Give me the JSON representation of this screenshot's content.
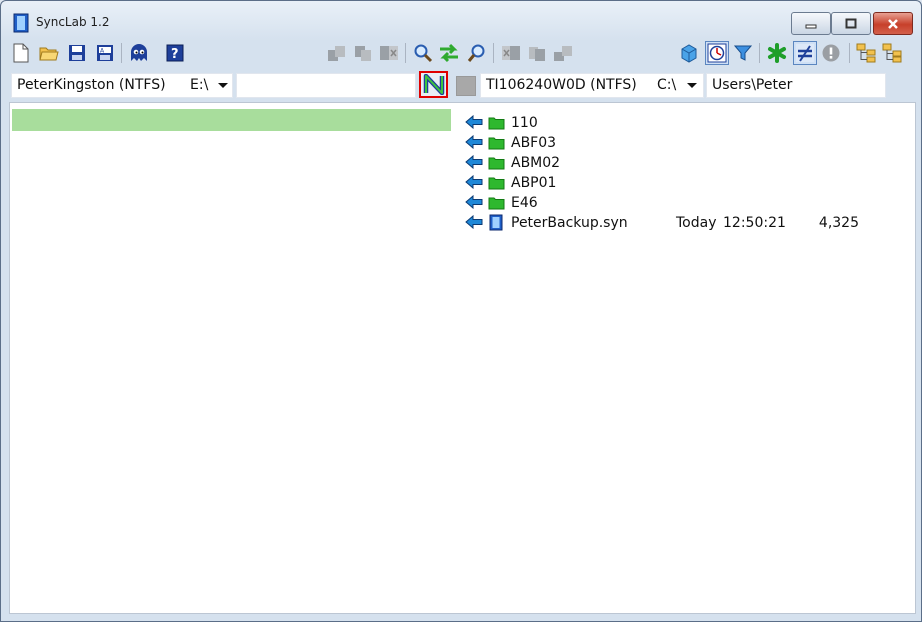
{
  "window": {
    "title": "SyncLab 1.2"
  },
  "left": {
    "volume": "PeterKingston (NTFS)",
    "drive": "E:\\",
    "path": ""
  },
  "right": {
    "volume": "TI106240W0D (NTFS)",
    "drive": "C:\\",
    "path": "Users\\Peter"
  },
  "files": [
    {
      "name": "110",
      "type": "folder",
      "date": "",
      "time": "",
      "size": ""
    },
    {
      "name": "ABF03",
      "type": "folder",
      "date": "",
      "time": "",
      "size": ""
    },
    {
      "name": "ABM02",
      "type": "folder",
      "date": "",
      "time": "",
      "size": ""
    },
    {
      "name": "ABP01",
      "type": "folder",
      "date": "",
      "time": "",
      "size": ""
    },
    {
      "name": "E46",
      "type": "folder",
      "date": "",
      "time": "",
      "size": ""
    },
    {
      "name": "PeterBackup.syn",
      "type": "file",
      "date": "Today",
      "time": "12:50:21",
      "size": "4,325"
    }
  ],
  "colors": {
    "accent": "#e00000",
    "selection": "#a8dd9c",
    "folder": "#2eb82e",
    "arrow": "#1e88d8"
  }
}
